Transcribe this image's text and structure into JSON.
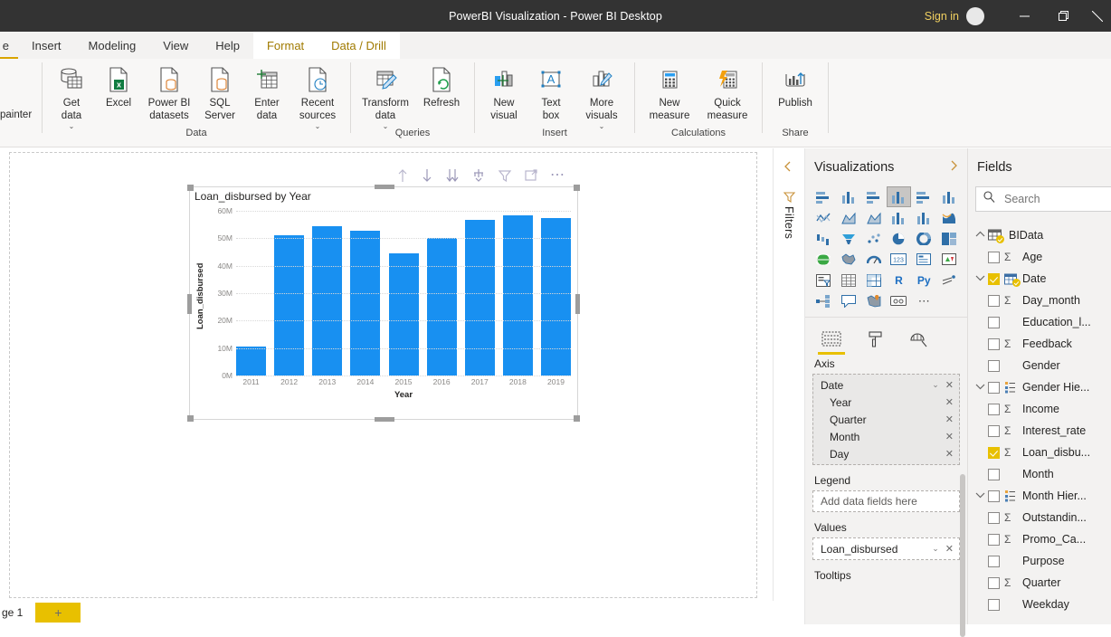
{
  "titlebar": {
    "title": "PowerBI Visualization - Power BI Desktop",
    "signin": "Sign in",
    "minimize": "minimize-icon",
    "restore": "restore-icon",
    "close": "close-icon"
  },
  "ribbon_tabs": [
    {
      "label": "e",
      "state": "partial"
    },
    {
      "label": "Insert",
      "state": "normal"
    },
    {
      "label": "Modeling",
      "state": "normal"
    },
    {
      "label": "View",
      "state": "normal"
    },
    {
      "label": "Help",
      "state": "normal"
    },
    {
      "label": "Format",
      "state": "context"
    },
    {
      "label": "Data / Drill",
      "state": "context"
    }
  ],
  "ribbon": {
    "left_cut_label": "painter",
    "groups": [
      {
        "name": "Data",
        "items": [
          {
            "label": "Get\ndata",
            "icon": "database-table-icon",
            "caret": true
          },
          {
            "label": "Excel",
            "icon": "excel-file-icon",
            "caret": false
          },
          {
            "label": "Power BI\ndatasets",
            "icon": "powerbi-dataset-icon",
            "caret": false
          },
          {
            "label": "SQL\nServer",
            "icon": "sql-server-icon",
            "caret": false
          },
          {
            "label": "Enter\ndata",
            "icon": "enter-data-grid-icon",
            "caret": false
          },
          {
            "label": "Recent\nsources",
            "icon": "recent-sources-clock-icon",
            "caret": true
          }
        ]
      },
      {
        "name": "Queries",
        "items": [
          {
            "label": "Transform\ndata",
            "icon": "transform-data-pencil-icon",
            "caret": true
          },
          {
            "label": "Refresh",
            "icon": "refresh-arrows-icon",
            "caret": false
          }
        ]
      },
      {
        "name": "Insert",
        "items": [
          {
            "label": "New\nvisual",
            "icon": "new-visual-icon",
            "caret": false
          },
          {
            "label": "Text\nbox",
            "icon": "text-box-icon",
            "caret": false
          },
          {
            "label": "More\nvisuals",
            "icon": "more-visuals-icon",
            "caret": true
          }
        ]
      },
      {
        "name": "Calculations",
        "items": [
          {
            "label": "New\nmeasure",
            "icon": "calculator-icon",
            "caret": false
          },
          {
            "label": "Quick\nmeasure",
            "icon": "quick-measure-lightning-icon",
            "caret": false
          }
        ]
      },
      {
        "name": "Share",
        "items": [
          {
            "label": "Publish",
            "icon": "publish-upload-icon",
            "caret": false
          }
        ]
      }
    ]
  },
  "visual_toolbar": [
    "drill-up-arrow-icon",
    "drill-down-arrow-icon",
    "expand-all-down-icon",
    "drill-mode-icon",
    "filter-funnel-icon",
    "focus-mode-icon",
    "more-options-ellipsis-icon"
  ],
  "chart_data": {
    "type": "bar",
    "title": "Loan_disbursed by Year",
    "xlabel": "Year",
    "ylabel": "Loan_disbursed",
    "categories": [
      "2011",
      "2012",
      "2013",
      "2014",
      "2015",
      "2016",
      "2017",
      "2018",
      "2019"
    ],
    "values": [
      10700000,
      51000000,
      54500000,
      52700000,
      44500000,
      50000000,
      56700000,
      58400000,
      57400000
    ],
    "ylim": [
      0,
      60000000
    ],
    "ytick_labels": [
      "60M",
      "50M",
      "40M",
      "30M",
      "20M",
      "10M",
      "0M"
    ],
    "ytick_values": [
      60000000,
      50000000,
      40000000,
      30000000,
      20000000,
      10000000,
      0
    ],
    "grid": true,
    "legend": "none",
    "bar_color": "#1890f1",
    "series_name": "Loan_disbursed"
  },
  "filters_rail": {
    "collapse_icon": "chevron-left-icon",
    "icon": "filter-funnel-icon",
    "label": "Filters"
  },
  "visualizations": {
    "title": "Visualizations",
    "expand_icon": "chevron-right-icon",
    "gallery": [
      "stacked-bar-chart-icon",
      "stacked-column-chart-icon",
      "clustered-bar-chart-icon",
      "clustered-column-chart-icon",
      "hundred-percent-stacked-bar-icon",
      "hundred-percent-stacked-column-icon",
      "line-chart-icon",
      "area-chart-icon",
      "stacked-area-chart-icon",
      "line-stacked-column-icon",
      "line-clustered-column-icon",
      "ribbon-chart-icon",
      "waterfall-chart-icon",
      "funnel-chart-icon",
      "scatter-chart-icon",
      "pie-chart-icon",
      "donut-chart-icon",
      "treemap-icon",
      "map-icon",
      "filled-map-icon",
      "gauge-icon",
      "card-icon",
      "multi-row-card-icon",
      "kpi-icon",
      "slicer-icon",
      "table-icon",
      "matrix-icon",
      "r-script-visual-icon",
      "python-visual-icon",
      "key-influencers-icon",
      "decomposition-tree-icon",
      "smart-narrative-icon",
      "arcgis-maps-icon",
      "paginated-report-icon",
      "get-more-visuals-ellipsis-icon"
    ],
    "selected_gallery_index": 3,
    "format_tabs": [
      {
        "icon": "fields-pane-icon",
        "active": true
      },
      {
        "icon": "format-paint-roller-icon",
        "active": false
      },
      {
        "icon": "analytics-magnifier-icon",
        "active": false
      }
    ],
    "wells": [
      {
        "label": "Axis",
        "kind": "filled",
        "items": [
          {
            "text": "Date",
            "indent": false,
            "chevron": true,
            "remove": true
          },
          {
            "text": "Year",
            "indent": true,
            "chevron": false,
            "remove": true
          },
          {
            "text": "Quarter",
            "indent": true,
            "chevron": false,
            "remove": true
          },
          {
            "text": "Month",
            "indent": true,
            "chevron": false,
            "remove": true
          },
          {
            "text": "Day",
            "indent": true,
            "chevron": false,
            "remove": true
          }
        ]
      },
      {
        "label": "Legend",
        "kind": "empty",
        "placeholder": "Add data fields here",
        "items": []
      },
      {
        "label": "Values",
        "kind": "filled",
        "items": [
          {
            "text": "Loan_disbursed",
            "indent": false,
            "chevron": true,
            "remove": true
          }
        ]
      },
      {
        "label": "Tooltips",
        "kind": "none",
        "items": []
      }
    ]
  },
  "fields": {
    "title": "Fields",
    "search_placeholder": "Search",
    "search_value": "",
    "search_icon": "search-icon",
    "table": {
      "name": "BIData",
      "expanded": true,
      "checked_badge": true
    },
    "items": [
      {
        "label": "Age",
        "checked": false,
        "sigma": true,
        "chevron": false,
        "icon": "none",
        "badge": false
      },
      {
        "label": "Date",
        "checked": true,
        "sigma": false,
        "chevron": true,
        "icon": "calendar-icon",
        "badge": true
      },
      {
        "label": "Day_month",
        "checked": false,
        "sigma": true,
        "chevron": false,
        "icon": "none",
        "badge": false
      },
      {
        "label": "Education_l...",
        "checked": false,
        "sigma": false,
        "chevron": false,
        "icon": "none",
        "badge": false
      },
      {
        "label": "Feedback",
        "checked": false,
        "sigma": true,
        "chevron": false,
        "icon": "none",
        "badge": false
      },
      {
        "label": "Gender",
        "checked": false,
        "sigma": false,
        "chevron": false,
        "icon": "none",
        "badge": false
      },
      {
        "label": "Gender Hie...",
        "checked": false,
        "sigma": false,
        "chevron": true,
        "icon": "hierarchy-icon",
        "badge": false
      },
      {
        "label": "Income",
        "checked": false,
        "sigma": true,
        "chevron": false,
        "icon": "none",
        "badge": false
      },
      {
        "label": "Interest_rate",
        "checked": false,
        "sigma": true,
        "chevron": false,
        "icon": "none",
        "badge": false
      },
      {
        "label": "Loan_disbu...",
        "checked": true,
        "sigma": true,
        "chevron": false,
        "icon": "none",
        "badge": false
      },
      {
        "label": "Month",
        "checked": false,
        "sigma": false,
        "chevron": false,
        "icon": "none",
        "badge": false
      },
      {
        "label": "Month Hier...",
        "checked": false,
        "sigma": false,
        "chevron": true,
        "icon": "hierarchy-icon",
        "badge": false
      },
      {
        "label": "Outstandin...",
        "checked": false,
        "sigma": true,
        "chevron": false,
        "icon": "none",
        "badge": false
      },
      {
        "label": "Promo_Ca...",
        "checked": false,
        "sigma": true,
        "chevron": false,
        "icon": "none",
        "badge": false
      },
      {
        "label": "Purpose",
        "checked": false,
        "sigma": false,
        "chevron": false,
        "icon": "none",
        "badge": false
      },
      {
        "label": "Quarter",
        "checked": false,
        "sigma": true,
        "chevron": false,
        "icon": "none",
        "badge": false
      },
      {
        "label": "Weekday",
        "checked": false,
        "sigma": false,
        "chevron": false,
        "icon": "none",
        "badge": false
      }
    ]
  },
  "bottom": {
    "page_label": "ge 1",
    "add_page_label": "+"
  }
}
